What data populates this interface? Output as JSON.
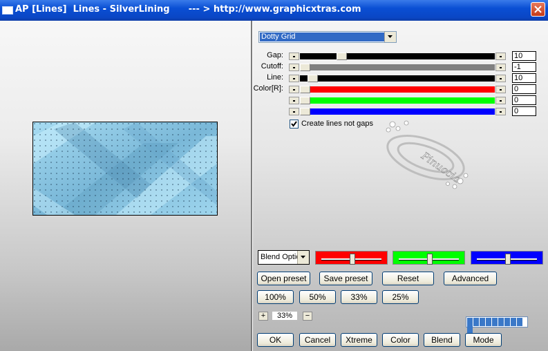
{
  "window": {
    "title": "AP [Lines]  Lines - SilverLining      --- > http://www.graphicxtras.com"
  },
  "icons": {
    "app": "window-icon",
    "close": "close-icon",
    "dropdown": "chevron-down-icon"
  },
  "preset_dropdown": {
    "value": "Dotty Grid"
  },
  "sliders": [
    {
      "label": "Gap:",
      "value": "10",
      "fill_color": "#000000",
      "level": 0.2
    },
    {
      "label": "Cutoff:",
      "value": "-1",
      "fill_color": "#808080",
      "level": 0.0
    },
    {
      "label": "Line:",
      "value": "10",
      "fill_color": "#000000",
      "level": 0.04
    },
    {
      "label": "Color[R]:",
      "value": "0",
      "fill_color": "#ff0000",
      "level": 0.0
    },
    {
      "label": "",
      "value": "0",
      "fill_color": "#00ff00",
      "level": 0.0
    },
    {
      "label": "",
      "value": "0",
      "fill_color": "#0000ff",
      "level": 0.0
    }
  ],
  "create_lines_checkbox": {
    "label": "Create lines not gaps",
    "checked": true
  },
  "watermark": {
    "text": "Pinuccia"
  },
  "blend_dropdown": {
    "value": "Blend Optio"
  },
  "color_bars": [
    {
      "name": "red",
      "color": "#ff0000",
      "level": 0.5
    },
    {
      "name": "green",
      "color": "#00ff00",
      "level": 0.5
    },
    {
      "name": "blue",
      "color": "#0000ff",
      "level": 0.5
    }
  ],
  "preset_buttons": {
    "open": "Open preset",
    "save": "Save preset",
    "reset": "Reset",
    "advanced": "Advanced"
  },
  "zoom_buttons": [
    "100%",
    "50%",
    "33%",
    "25%"
  ],
  "zoom": {
    "plus": "+",
    "minus": "−",
    "value": "33%"
  },
  "progress": {
    "segments": 10,
    "filled": 10
  },
  "bottom_buttons": {
    "ok": "OK",
    "cancel": "Cancel",
    "xtreme": "Xtreme",
    "color": "Color",
    "blend": "Blend",
    "mode": "Mode"
  }
}
